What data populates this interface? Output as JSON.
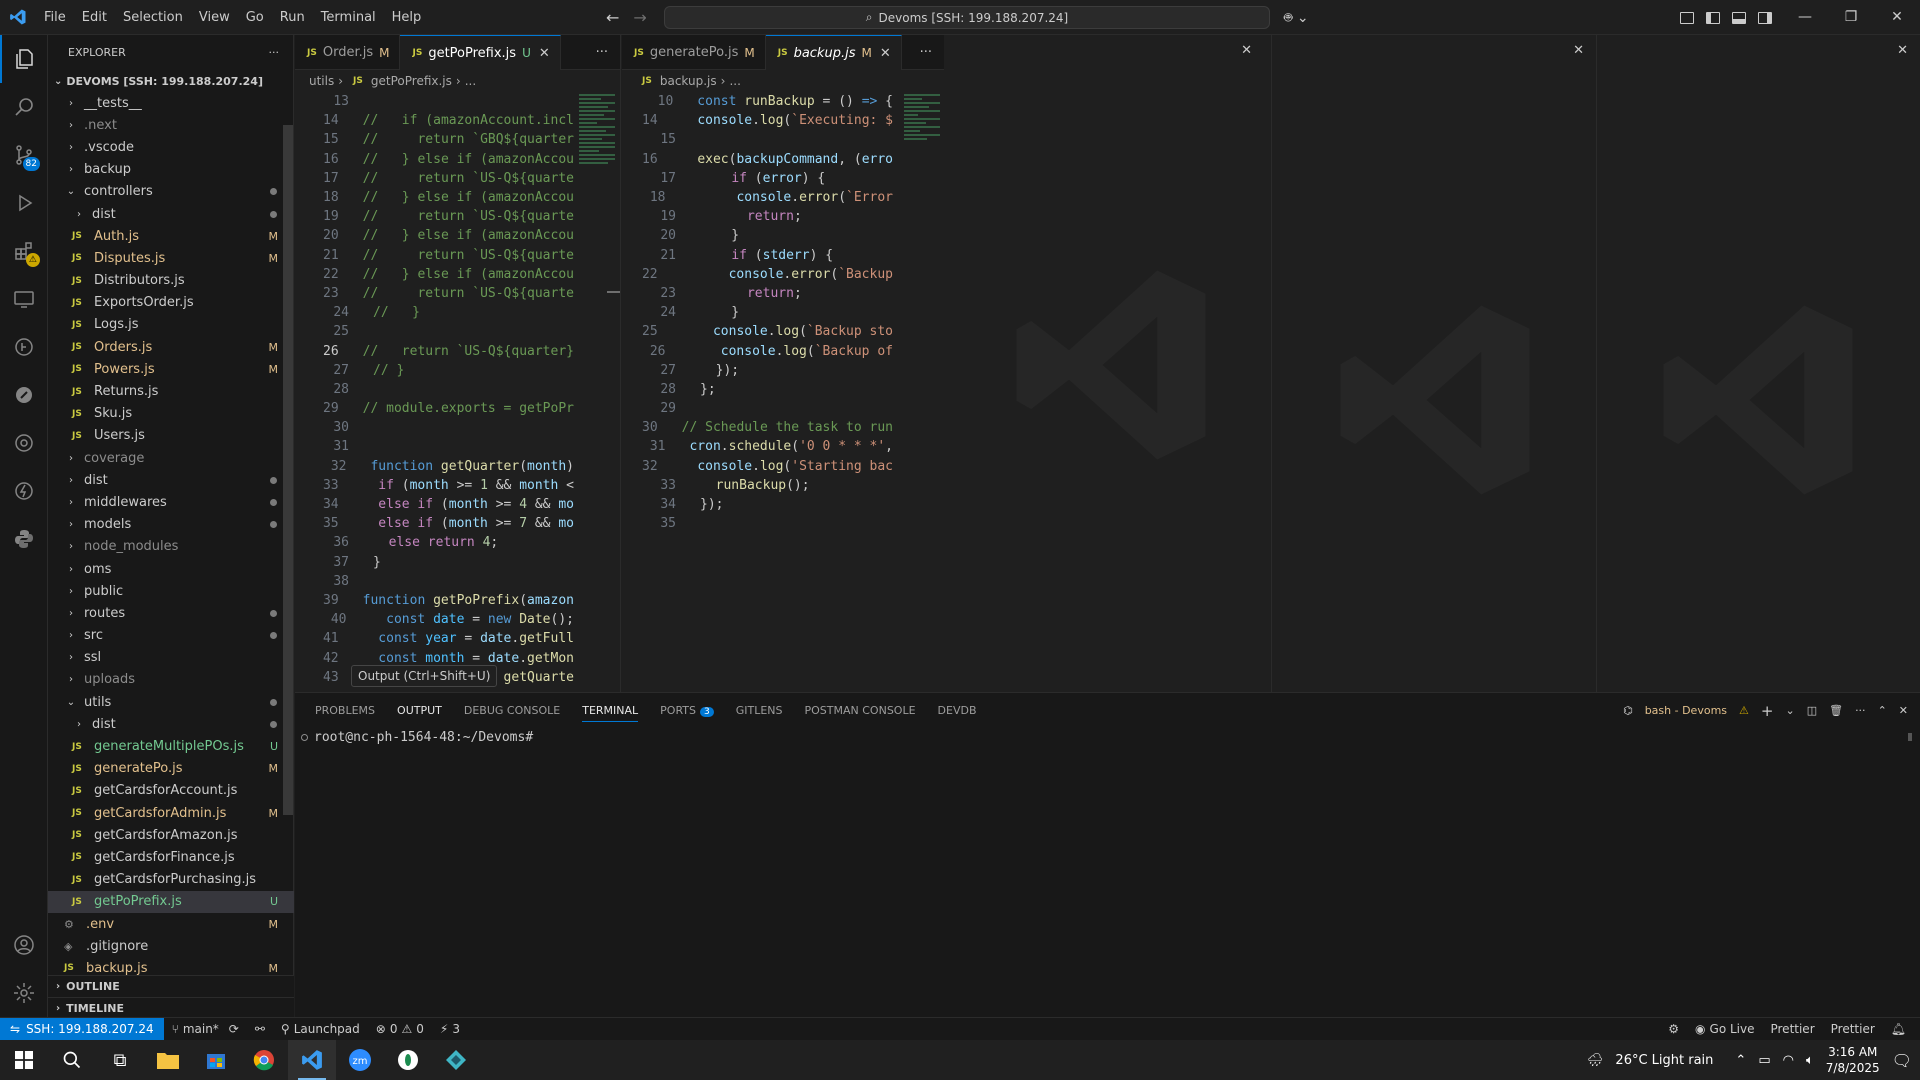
{
  "titlebar": {
    "menu": [
      "File",
      "Edit",
      "Selection",
      "View",
      "Go",
      "Run",
      "Terminal",
      "Help"
    ],
    "command_center": "Devoms [SSH: 199.188.207.24]"
  },
  "activitybar": {
    "scm_badge": "82"
  },
  "sidebar": {
    "title": "EXPLORER",
    "root": "DEVOMS [SSH: 199.188.207.24]",
    "tree": [
      {
        "label": "__tests__",
        "kind": "folder",
        "depth": 0,
        "open": false,
        "status": ""
      },
      {
        "label": ".next",
        "kind": "folder",
        "depth": 0,
        "open": false,
        "status": "",
        "dim": true
      },
      {
        "label": ".vscode",
        "kind": "folder",
        "depth": 0,
        "open": false,
        "status": ""
      },
      {
        "label": "backup",
        "kind": "folder",
        "depth": 0,
        "open": false,
        "status": ""
      },
      {
        "label": "controllers",
        "kind": "folder",
        "depth": 0,
        "open": true,
        "status": "dot",
        "mod": true
      },
      {
        "label": "dist",
        "kind": "folder",
        "depth": 1,
        "open": false,
        "status": "dot"
      },
      {
        "label": "Auth.js",
        "kind": "js",
        "depth": 1,
        "status": "M"
      },
      {
        "label": "Disputes.js",
        "kind": "js",
        "depth": 1,
        "status": "M"
      },
      {
        "label": "Distributors.js",
        "kind": "js",
        "depth": 1,
        "status": ""
      },
      {
        "label": "ExportsOrder.js",
        "kind": "js",
        "depth": 1,
        "status": ""
      },
      {
        "label": "Logs.js",
        "kind": "js",
        "depth": 1,
        "status": ""
      },
      {
        "label": "Orders.js",
        "kind": "js",
        "depth": 1,
        "status": "M"
      },
      {
        "label": "Powers.js",
        "kind": "js",
        "depth": 1,
        "status": "M"
      },
      {
        "label": "Returns.js",
        "kind": "js",
        "depth": 1,
        "status": ""
      },
      {
        "label": "Sku.js",
        "kind": "js",
        "depth": 1,
        "status": ""
      },
      {
        "label": "Users.js",
        "kind": "js",
        "depth": 1,
        "status": ""
      },
      {
        "label": "coverage",
        "kind": "folder",
        "depth": 0,
        "open": false,
        "status": "",
        "dim": true
      },
      {
        "label": "dist",
        "kind": "folder",
        "depth": 0,
        "open": false,
        "status": "dot"
      },
      {
        "label": "middlewares",
        "kind": "folder",
        "depth": 0,
        "open": false,
        "status": "dot"
      },
      {
        "label": "models",
        "kind": "folder",
        "depth": 0,
        "open": false,
        "status": "dot"
      },
      {
        "label": "node_modules",
        "kind": "folder",
        "depth": 0,
        "open": false,
        "status": "",
        "dim": true
      },
      {
        "label": "oms",
        "kind": "folder",
        "depth": 0,
        "open": false,
        "status": ""
      },
      {
        "label": "public",
        "kind": "folder",
        "depth": 0,
        "open": false,
        "status": ""
      },
      {
        "label": "routes",
        "kind": "folder",
        "depth": 0,
        "open": false,
        "status": "dot"
      },
      {
        "label": "src",
        "kind": "folder",
        "depth": 0,
        "open": false,
        "status": "dot"
      },
      {
        "label": "ssl",
        "kind": "folder",
        "depth": 0,
        "open": false,
        "status": ""
      },
      {
        "label": "uploads",
        "kind": "folder",
        "depth": 0,
        "open": false,
        "status": "",
        "dim": true
      },
      {
        "label": "utils",
        "kind": "folder",
        "depth": 0,
        "open": true,
        "status": "dot"
      },
      {
        "label": "dist",
        "kind": "folder",
        "depth": 1,
        "open": false,
        "status": "dot"
      },
      {
        "label": "generateMultiplePOs.js",
        "kind": "js",
        "depth": 1,
        "status": "U"
      },
      {
        "label": "generatePo.js",
        "kind": "js",
        "depth": 1,
        "status": "M"
      },
      {
        "label": "getCardsforAccount.js",
        "kind": "js",
        "depth": 1,
        "status": ""
      },
      {
        "label": "getCardsforAdmin.js",
        "kind": "js",
        "depth": 1,
        "status": "M"
      },
      {
        "label": "getCardsforAmazon.js",
        "kind": "js",
        "depth": 1,
        "status": ""
      },
      {
        "label": "getCardsforFinance.js",
        "kind": "js",
        "depth": 1,
        "status": ""
      },
      {
        "label": "getCardsforPurchasing.js",
        "kind": "js",
        "depth": 1,
        "status": ""
      },
      {
        "label": "getPoPrefix.js",
        "kind": "js",
        "depth": 1,
        "status": "U",
        "selected": true
      },
      {
        "label": ".env",
        "kind": "gear",
        "depth": 0,
        "status": "M"
      },
      {
        "label": ".gitignore",
        "kind": "git",
        "depth": 0,
        "status": ""
      },
      {
        "label": "backup.js",
        "kind": "js",
        "depth": 0,
        "status": "M"
      }
    ],
    "outline": "OUTLINE",
    "timeline": "TIMELINE"
  },
  "group1": {
    "tabs": [
      {
        "name": "Order.js",
        "status": "M",
        "active": false
      },
      {
        "name": "getPoPrefix.js",
        "status": "U",
        "active": true
      }
    ],
    "crumbs": [
      "utils",
      "getPoPrefix.js",
      "..."
    ],
    "lines": [
      {
        "n": "13",
        "html": ""
      },
      {
        "n": "14",
        "html": "<span class='cm'>//   if (amazonAccount.incl</span>"
      },
      {
        "n": "15",
        "html": "<span class='cm'>//     return `GBQ${quarter</span>"
      },
      {
        "n": "16",
        "html": "<span class='cm'>//   } else if (amazonAccou</span>"
      },
      {
        "n": "17",
        "html": "<span class='cm'>//     return `US-Q${quarte</span>"
      },
      {
        "n": "18",
        "html": "<span class='cm'>//   } else if (amazonAccou</span>"
      },
      {
        "n": "19",
        "html": "<span class='cm'>//     return `US-Q${quarte</span>"
      },
      {
        "n": "20",
        "html": "<span class='cm'>//   } else if (amazonAccou</span>"
      },
      {
        "n": "21",
        "html": "<span class='cm'>//     return `US-Q${quarte</span>"
      },
      {
        "n": "22",
        "html": "<span class='cm'>//   } else if (amazonAccou</span>"
      },
      {
        "n": "23",
        "html": "<span class='cm'>//     return `US-Q${quarte</span>"
      },
      {
        "n": "24",
        "html": "<span class='cm'>//   }</span>"
      },
      {
        "n": "25",
        "html": ""
      },
      {
        "n": "26",
        "html": "<span class='cm'>//   return `US-Q${quarter}</span>",
        "current": true
      },
      {
        "n": "27",
        "html": "<span class='cm'>// }</span>"
      },
      {
        "n": "28",
        "html": ""
      },
      {
        "n": "29",
        "html": "<span class='cm'>// module.exports = getPoPr</span>"
      },
      {
        "n": "30",
        "html": ""
      },
      {
        "n": "31",
        "html": ""
      },
      {
        "n": "32",
        "html": "<span class='kw'>function</span> <span class='fn'>getQuarter</span>(<span class='vr'>month</span>)"
      },
      {
        "n": "33",
        "html": "  <span class='kc'>if</span> (<span class='vr'>month</span> &gt;= <span class='nm'>1</span> &amp;&amp; <span class='vr'>month</span> &lt;"
      },
      {
        "n": "34",
        "html": "  <span class='kc'>else if</span> (<span class='vr'>month</span> &gt;= <span class='nm'>4</span> &amp;&amp; <span class='vr'>mo</span>"
      },
      {
        "n": "35",
        "html": "  <span class='kc'>else if</span> (<span class='vr'>month</span> &gt;= <span class='nm'>7</span> &amp;&amp; <span class='vr'>mo</span>"
      },
      {
        "n": "36",
        "html": "  <span class='kc'>else return</span> <span class='nm'>4</span>;"
      },
      {
        "n": "37",
        "html": "}"
      },
      {
        "n": "38",
        "html": ""
      },
      {
        "n": "39",
        "html": "<span class='kw'>function</span> <span class='fn'>getPoPrefix</span>(<span class='vr'>amazon</span>"
      },
      {
        "n": "40",
        "html": "  <span class='kw'>const</span> <span class='cn'>date</span> = <span class='kw'>new</span> <span class='fn'>Date</span>();"
      },
      {
        "n": "41",
        "html": "  <span class='kw'>const</span> <span class='cn'>year</span> = <span class='vr'>date</span>.<span class='fn'>getFull</span>"
      },
      {
        "n": "42",
        "html": "  <span class='kw'>const</span> <span class='cn'>month</span> = <span class='vr'>date</span>.<span class='fn'>getMon</span>"
      },
      {
        "n": "43",
        "html": "                = <span class='fn'>getQuarte</span>"
      }
    ]
  },
  "group2": {
    "tabs": [
      {
        "name": "generatePo.js",
        "status": "M",
        "active": false
      },
      {
        "name": "backup.js",
        "status": "M",
        "active": true
      }
    ],
    "crumbs": [
      "backup.js",
      "..."
    ],
    "lines": [
      {
        "n": "10",
        "html": "<span class='kw'>const</span> <span class='fn'>runBackup</span> = () <span class='kw'>=&gt;</span> {"
      },
      {
        "n": "14",
        "html": "  <span class='vr'>console</span>.<span class='fn'>log</span>(<span class='st2'>`Executing: $</span>"
      },
      {
        "n": "15",
        "html": ""
      },
      {
        "n": "16",
        "html": "  <span class='fn'>exec</span>(<span class='vr'>backupCommand</span>, (<span class='vr'>erro</span>"
      },
      {
        "n": "17",
        "html": "    <span class='kc'>if</span> (<span class='vr'>error</span>) {"
      },
      {
        "n": "18",
        "html": "      <span class='vr'>console</span>.<span class='fn'>error</span>(<span class='st2'>`Error</span>"
      },
      {
        "n": "19",
        "html": "      <span class='kc'>return</span>;"
      },
      {
        "n": "20",
        "html": "    }"
      },
      {
        "n": "21",
        "html": "    <span class='kc'>if</span> (<span class='vr'>stderr</span>) {"
      },
      {
        "n": "22",
        "html": "      <span class='vr'>console</span>.<span class='fn'>error</span>(<span class='st2'>`Backup</span>"
      },
      {
        "n": "23",
        "html": "      <span class='kc'>return</span>;"
      },
      {
        "n": "24",
        "html": "    }"
      },
      {
        "n": "25",
        "html": "    <span class='vr'>console</span>.<span class='fn'>log</span>(<span class='st2'>`Backup sto</span>"
      },
      {
        "n": "26",
        "html": "    <span class='vr'>console</span>.<span class='fn'>log</span>(<span class='st2'>`Backup of</span>"
      },
      {
        "n": "27",
        "html": "  });"
      },
      {
        "n": "28",
        "html": "};"
      },
      {
        "n": "29",
        "html": ""
      },
      {
        "n": "30",
        "html": "<span class='cm'>// Schedule the task to run</span>"
      },
      {
        "n": "31",
        "html": "<span class='vr'>cron</span>.<span class='fn'>schedule</span>(<span class='st2'>'0 0 * * *'</span>,"
      },
      {
        "n": "32",
        "html": "  <span class='vr'>console</span>.<span class='fn'>log</span>(<span class='st2'>'Starting bac</span>"
      },
      {
        "n": "33",
        "html": "  <span class='fn'>runBackup</span>();"
      },
      {
        "n": "34",
        "html": "});"
      },
      {
        "n": "35",
        "html": ""
      }
    ]
  },
  "panel": {
    "tabs": [
      {
        "label": "PROBLEMS",
        "active": false
      },
      {
        "label": "OUTPUT",
        "active": false,
        "bright": true
      },
      {
        "label": "DEBUG CONSOLE",
        "active": false
      },
      {
        "label": "TERMINAL",
        "active": true
      },
      {
        "label": "PORTS",
        "active": false,
        "badge": "3"
      },
      {
        "label": "GITLENS",
        "active": false
      },
      {
        "label": "POSTMAN CONSOLE",
        "active": false
      },
      {
        "label": "DEVDB",
        "active": false
      }
    ],
    "shell_label": "bash - Devoms",
    "prompt": "root@nc-ph-1564-48:~/Devoms#"
  },
  "tooltip": "Output (Ctrl+Shift+U)",
  "statusbar": {
    "remote": "SSH: 199.188.207.24",
    "branch": "main*",
    "launchpad": "Launchpad",
    "errors": "0",
    "warnings": "0",
    "ports": "3",
    "golive": "Go Live",
    "prettier1": "Prettier",
    "prettier2": "Prettier"
  },
  "taskbar": {
    "weather": "26°C  Light rain",
    "time": "3:16 AM",
    "date": "7/8/2025"
  }
}
